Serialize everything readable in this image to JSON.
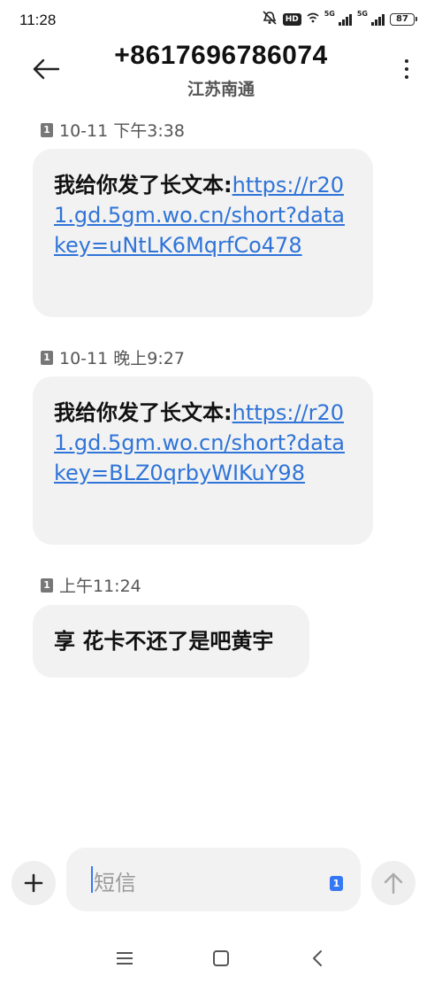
{
  "status_bar": {
    "time": "11:28",
    "hd": "HD",
    "net1": "5G",
    "net2": "5G",
    "battery": "87"
  },
  "header": {
    "title": "+8617696786074",
    "subtitle": "江苏南通"
  },
  "messages": [
    {
      "sim": "1",
      "time": "10-11 下午3:38",
      "text": "我给你发了长文本:",
      "link": "https://r201.gd.5gm.wo.cn/short?datakey=uNtLK6MqrfCo478"
    },
    {
      "sim": "1",
      "time": "10-11 晚上9:27",
      "text": "我给你发了长文本:",
      "link": "https://r201.gd.5gm.wo.cn/short?datakey=BLZ0qrbyWIKuY98"
    },
    {
      "sim": "1",
      "time": "上午11:24",
      "text": "享 花卡不还了是吧黄宇",
      "link": ""
    }
  ],
  "composer": {
    "placeholder": "短信",
    "sim": "1"
  },
  "colors": {
    "link": "#2f74d8",
    "bubble": "#f2f2f2",
    "accent": "#3478f6"
  },
  "icons": [
    "back-arrow-icon",
    "more-vert-icon",
    "plus-icon",
    "send-arrow-icon",
    "menu-icon",
    "home-icon",
    "back-icon",
    "mute-icon",
    "wifi-icon"
  ]
}
